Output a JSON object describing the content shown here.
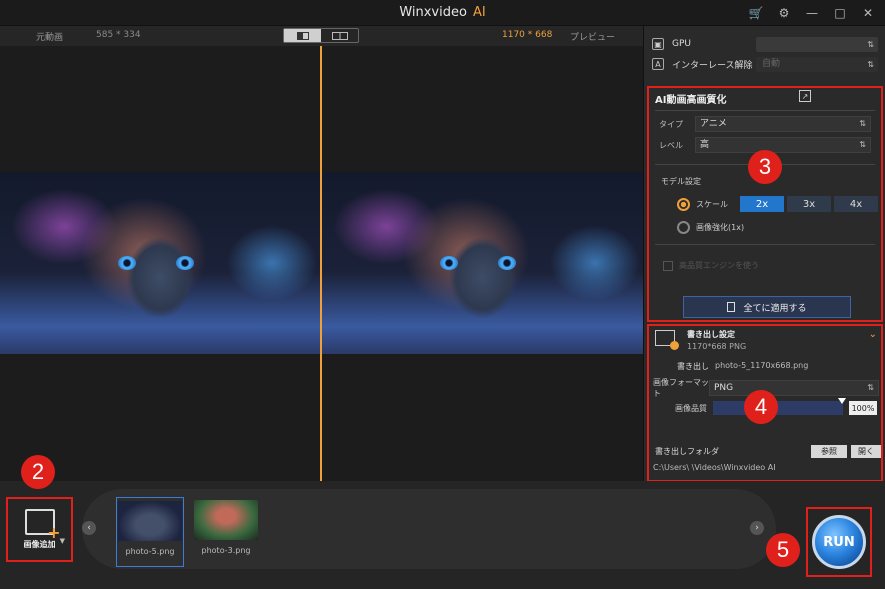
{
  "titlebar": {
    "app_name": "Winxvideo",
    "ai_tag": "AI",
    "icons": [
      "cart-icon",
      "settings-icon",
      "minimize-icon",
      "maximize-icon",
      "close-icon"
    ]
  },
  "preview": {
    "original_label": "元動画",
    "original_resolution": "585 * 334",
    "output_resolution": "1170 * 668",
    "preview_label": "プレビュー"
  },
  "settings": {
    "gpu_label": "GPU",
    "gpu_value": "",
    "deinterlace_label": "インターレース解除",
    "deinterlace_value": "自動"
  },
  "ai_section": {
    "title": "AI動画高画質化",
    "type_label": "タイプ",
    "type_value": "アニメ",
    "level_label": "レベル",
    "level_value": "高",
    "model_label": "モデル設定",
    "scale_label": "スケール",
    "scale_options": [
      "2x",
      "3x",
      "4x"
    ],
    "scale_selected": "2x",
    "enhance_label": "画像強化(1x)",
    "hq_engine_label": "高品質エンジンを使う",
    "apply_all_label": "全てに適用する"
  },
  "export_section": {
    "title": "書き出し設定",
    "summary": "1170*668  PNG",
    "output_label": "書き出し",
    "output_name": "photo-5_1170x668.png",
    "format_label": "画像フォーマット",
    "format_value": "PNG",
    "quality_label": "画像品質",
    "quality_value": "100%",
    "folder_label": "書き出しフォルダ",
    "browse_label": "参照",
    "open_label": "開く",
    "folder_path": "C:\\Users\\      \\Videos\\Winxvideo AI"
  },
  "bottom": {
    "add_label": "画像追加",
    "thumbnails": [
      {
        "name": "photo-5.png",
        "selected": true
      },
      {
        "name": "photo-3.png",
        "selected": false
      }
    ],
    "run_label": "RUN"
  },
  "callouts": [
    "2",
    "3",
    "4",
    "5"
  ],
  "colors": {
    "accent_orange": "#f0a03a",
    "callout_red": "#e0201a",
    "selected_blue": "#2277cc"
  }
}
